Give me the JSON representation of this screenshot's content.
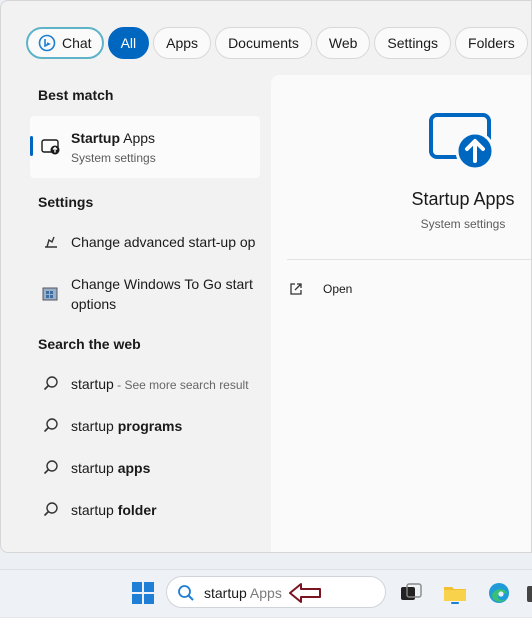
{
  "filters": [
    "Chat",
    "All",
    "Apps",
    "Documents",
    "Web",
    "Settings",
    "Folders"
  ],
  "sections": {
    "best_match": "Best match",
    "settings": "Settings",
    "search_web": "Search the web"
  },
  "best_match": {
    "title_bold": "Startup",
    "title_rest": " Apps",
    "subtitle": "System settings"
  },
  "settings_items": [
    {
      "label": "Change advanced start-up op",
      "icon": "startup-settings-icon"
    },
    {
      "label_line1": "Change Windows To Go start",
      "label_line2": "options",
      "icon": "windows-to-go-icon"
    }
  ],
  "web_items": [
    {
      "prefix": "startup",
      "suffix": " - See more search result"
    },
    {
      "prefix": "startup ",
      "bold": "programs"
    },
    {
      "prefix": "startup ",
      "bold": "apps"
    },
    {
      "prefix": "startup ",
      "bold": "folder"
    }
  ],
  "detail": {
    "title": "Startup Apps",
    "subtitle": "System settings",
    "open_label": "Open"
  },
  "taskbar": {
    "search_typed": "startup",
    "search_ghost": " Apps"
  },
  "colors": {
    "accent": "#0067c0",
    "arrow": "#7a1420"
  }
}
